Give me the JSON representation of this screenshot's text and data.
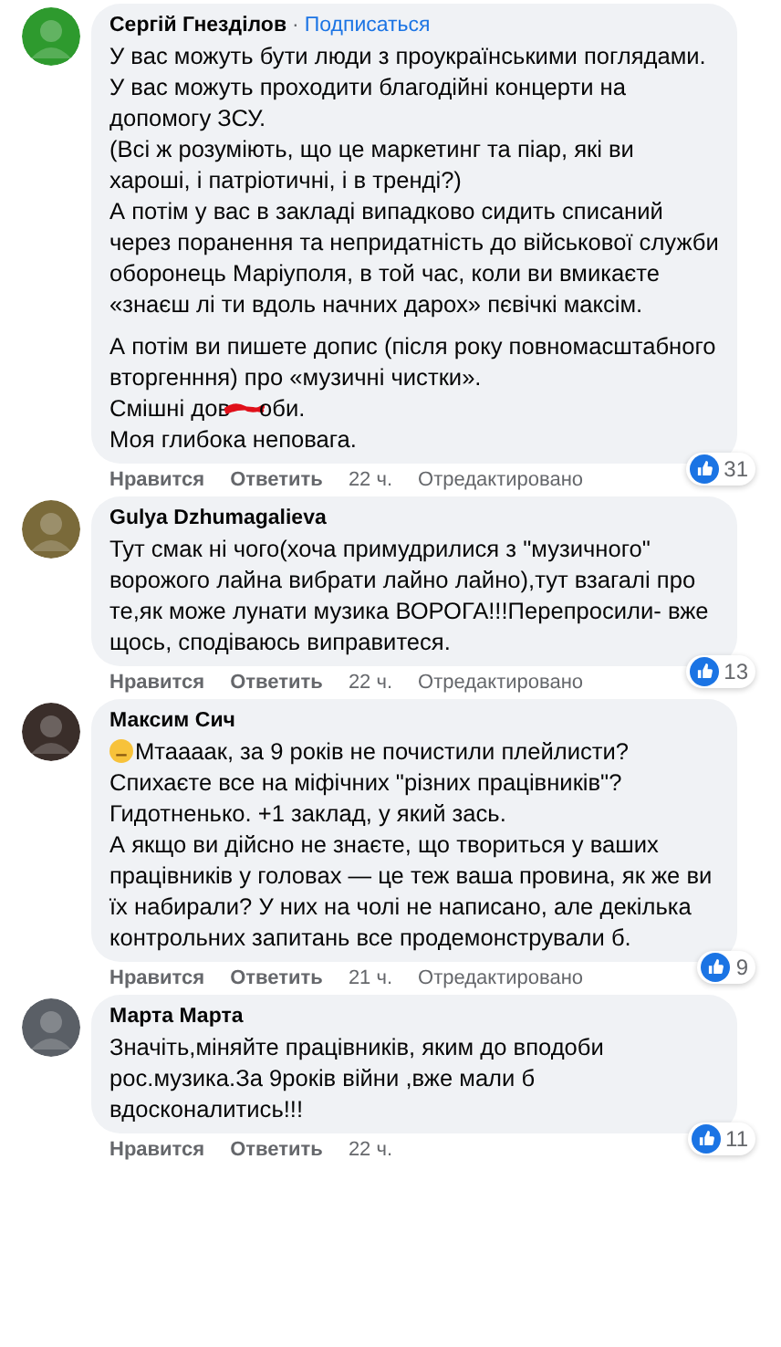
{
  "comments": [
    {
      "author": "Сергій Гнезділов",
      "separator": "·",
      "follow": "Подписаться",
      "blocks": [
        [
          "У вас можуть бути люди з проукраїнськими поглядами.",
          "У вас можуть проходити благодійні концерти на допомогу ЗСУ.",
          "(Всі ж розуміють, що це маркетинг та піар, які ви хароші, і патріотичні, і в тренді?)",
          "А потім у вас в закладі випадково сидить списаний через поранення та непридатність до військової служби оборонець Маріуполя, в той час, коли ви вмикаєте «знаєш лі ти вдоль начних дарох» пєвічкі максім."
        ],
        [
          "А потім ви пишете допис (після року повномасштабного вторгенння) про «музичні чистки».",
          {
            "kind": "censored",
            "before": "Смішні дов",
            "after": "оби."
          },
          "Моя глибока неповага."
        ]
      ],
      "likes": "31",
      "actions": {
        "like": "Нравится",
        "reply": "Ответить",
        "time": "22 ч.",
        "edited": "Отредактировано"
      }
    },
    {
      "author": "Gulya Dzhumagalieva",
      "blocks": [
        [
          "Тут смак ні чого(хоча примудрилися з \"музичного\" ворожого лайна вибрати лайно лайно),тут взагалі про те,як може лунати музика ВОРОГА!!!Перепросили- вже щось, сподіваюсь виправитеся."
        ]
      ],
      "likes": "13",
      "actions": {
        "like": "Нравится",
        "reply": "Ответить",
        "time": "22 ч.",
        "edited": "Отредактировано"
      }
    },
    {
      "author": "Максим Сич",
      "blocks": [
        [
          {
            "kind": "emoji",
            "text": "Мтаааак, за 9 років не почистили плейлисти?"
          },
          "Спихаєте все на міфічних \"різних працівників\"?",
          "Гидотненько. +1 заклад, у який зась.",
          "А якщо ви дійсно не знаєте, що твориться у ваших працівників у головах — це теж ваша провина, як же ви їх набирали? У них на чолі не написано, але декілька контрольних запитань все продемонстрували б."
        ]
      ],
      "likes": "9",
      "actions": {
        "like": "Нравится",
        "reply": "Ответить",
        "time": "21 ч.",
        "edited": "Отредактировано"
      }
    },
    {
      "author": "Марта Марта",
      "blocks": [
        [
          "Значіть,міняйте працівників, яким до вподоби рос.музика.За 9років війни ,вже мали б вдосконалитись!!!"
        ]
      ],
      "likes": "11",
      "actions": {
        "like": "Нравится",
        "reply": "Ответить",
        "time": "22 ч."
      }
    }
  ]
}
